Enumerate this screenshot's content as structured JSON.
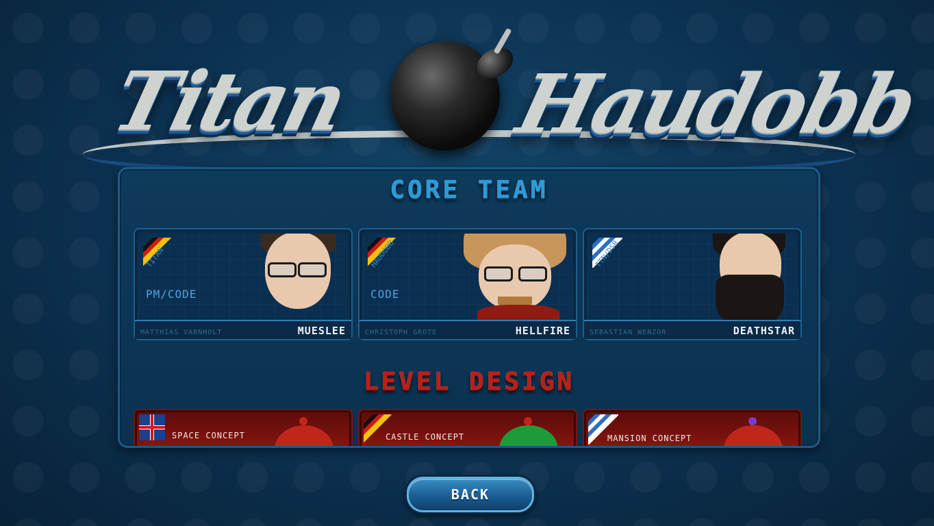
{
  "logo": {
    "left_word": "Titan",
    "right_word": "Haudobb"
  },
  "core_team": {
    "title": "CORE TEAM",
    "members": [
      {
        "flag": "germany",
        "team": "TITAN",
        "role": "PM/CODE",
        "real_name": "MATTHIAS VARNHOLT",
        "nick": "MUESLEE"
      },
      {
        "flag": "germany",
        "team": "HAUDOBB",
        "role": "CODE",
        "real_name": "CHRISTOPH GROTE",
        "nick": "HELLFIRE"
      },
      {
        "flag": "greece",
        "team": "TTN/DSR",
        "role": "",
        "real_name": "SEBASTIAN WENZOR",
        "nick": "DEATHSTAR"
      }
    ]
  },
  "level_design": {
    "title": "LEVEL DESIGN",
    "items": [
      {
        "flag": "uk",
        "label": "SPACE CONCEPT",
        "helmet_color": "#c0261c",
        "knob_color": "#c0261c"
      },
      {
        "flag": "germany",
        "label": "CASTLE CONCEPT",
        "helmet_color": "#1f9a3a",
        "knob_color": "#c0261c"
      },
      {
        "flag": "greece",
        "label": "MANSION CONCEPT",
        "helmet_color": "#c0261c",
        "knob_color": "#7a3bc4"
      }
    ]
  },
  "buttons": {
    "back_label": "BACK"
  }
}
